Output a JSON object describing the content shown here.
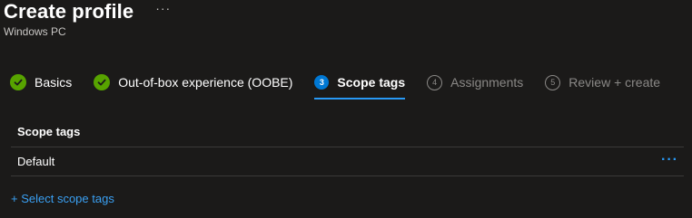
{
  "header": {
    "title": "Create profile",
    "more_label": "···",
    "subtitle": "Windows PC"
  },
  "steps": [
    {
      "label": "Basics",
      "state": "done"
    },
    {
      "label": "Out-of-box experience (OOBE)",
      "state": "done"
    },
    {
      "label": "Scope tags",
      "number": "3",
      "state": "current"
    },
    {
      "label": "Assignments",
      "number": "4",
      "state": "future"
    },
    {
      "label": "Review + create",
      "number": "5",
      "state": "future"
    }
  ],
  "table": {
    "header": "Scope tags",
    "rows": [
      {
        "name": "Default",
        "more_label": "···"
      }
    ]
  },
  "add_link": "+ Select scope tags",
  "colors": {
    "background": "#1b1a19",
    "accent": "#2899f5",
    "success": "#57a300",
    "disabled": "#8a8886"
  }
}
